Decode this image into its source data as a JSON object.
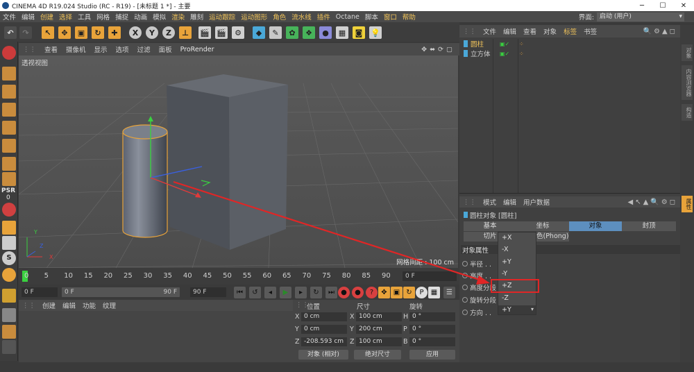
{
  "titlebar": {
    "title": "CINEMA 4D R19.024 Studio (RC - R19) - [未标题 1 *] - 主要",
    "min": "─",
    "max": "☐",
    "close": "✕"
  },
  "menubar": {
    "items": [
      "文件",
      "编辑",
      "创建",
      "选择",
      "工具",
      "网格",
      "捕捉",
      "动画",
      "模拟",
      "渲染",
      "雕刻",
      "运动跟踪",
      "运动图形",
      "角色",
      "流水线",
      "插件",
      "Octane",
      "脚本",
      "窗口",
      "帮助"
    ],
    "layout_label": "界面:",
    "layout_value": "启动 (用户)"
  },
  "toolbar": {
    "axis_x": "X",
    "axis_y": "Y",
    "axis_z": "Z"
  },
  "lefttools": {
    "psr": "PSR",
    "psr_value": "0",
    "s": "S"
  },
  "viewport_menu": {
    "items": [
      "查看",
      "摄像机",
      "显示",
      "选项",
      "过滤",
      "面板"
    ],
    "prorender": "ProRender"
  },
  "viewport": {
    "label": "透视视图",
    "grid": "网格间距 : 100 cm",
    "axis_y": "Y",
    "axis_x": "X",
    "axis_z": "Z"
  },
  "timeline": {
    "ticks": [
      "0",
      "5",
      "10",
      "15",
      "20",
      "25",
      "30",
      "35",
      "40",
      "45",
      "50",
      "55",
      "60",
      "65",
      "70",
      "75",
      "80",
      "85",
      "90"
    ],
    "current": "0 F"
  },
  "playbar": {
    "start": "0 F",
    "range_start": "0 F",
    "range_end": "90 F",
    "end": "90 F"
  },
  "material_menu": [
    "创建",
    "编辑",
    "功能",
    "纹理"
  ],
  "coord": {
    "headers": {
      "pos": "位置",
      "size": "尺寸",
      "rot": "旋转"
    },
    "rows": [
      {
        "axis": "X",
        "pos": "0 cm",
        "saxis": "X",
        "size": "100 cm",
        "raxis": "H",
        "rot": "0 °"
      },
      {
        "axis": "Y",
        "pos": "0 cm",
        "saxis": "Y",
        "size": "200 cm",
        "raxis": "P",
        "rot": "0 °"
      },
      {
        "axis": "Z",
        "pos": "-208.593 cm",
        "saxis": "Z",
        "size": "100 cm",
        "raxis": "B",
        "rot": "0 °"
      }
    ],
    "mode1": "对象 (相对)",
    "mode2": "绝对尺寸",
    "apply": "应用"
  },
  "objmgr": {
    "menu": [
      "文件",
      "编辑",
      "查看",
      "对象",
      "标签",
      "书签"
    ],
    "objects": [
      {
        "name": "圆柱",
        "color": "#f0c35a"
      },
      {
        "name": "立方体",
        "color": "#cfcfcf"
      }
    ]
  },
  "rightstrip": [
    "对象",
    "内容浏览器",
    "构造"
  ],
  "attr": {
    "menu": [
      "模式",
      "编辑",
      "用户数据"
    ],
    "title": "圆柱对象 [圆柱]",
    "tabs": [
      "基本",
      "坐标",
      "对象",
      "封顶"
    ],
    "tabs2": [
      "切片"
    ],
    "phong": "平滑着色(Phong)",
    "section": "对象属性",
    "rows": [
      "半径 . .",
      "高度 . .",
      "高度分段",
      "旋转分段",
      "方向 . ."
    ],
    "direction": "+Y",
    "options": [
      "+X",
      "-X",
      "+Y",
      "-Y",
      "+Z",
      "-Z",
      "+Y"
    ],
    "side_tab": "属性"
  },
  "colors": {
    "accent": "#f0c35a",
    "active_tab": "#5d8fbf",
    "highlight": "#e02626",
    "selection": "#e8a33a"
  }
}
